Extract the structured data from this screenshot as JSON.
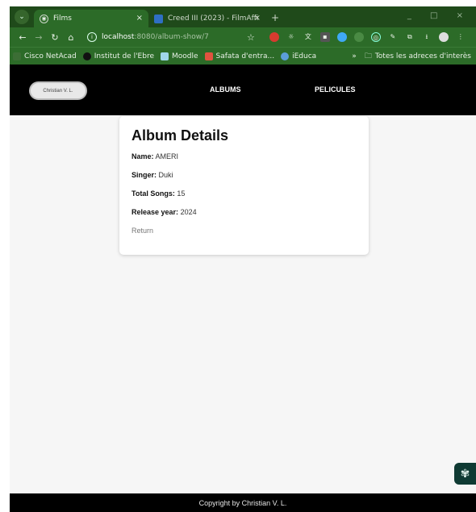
{
  "browser": {
    "tabs": [
      {
        "title": "Films",
        "close": "×"
      },
      {
        "title": "Creed III (2023) - FilmAffi",
        "close": "×"
      }
    ],
    "new_tab": "+",
    "url_host": "localhost",
    "url_path": ":8080/album-show/7",
    "bookmarks": [
      "Cisco NetAcad",
      "Institut de l'Ebre",
      "Moodle",
      "Safata d'entra...",
      "iEduca"
    ],
    "bookmarks_more": "»",
    "bookmarks_folder": "Totes les adreces d'interès"
  },
  "header": {
    "brand": "Christian V. L.",
    "nav": [
      "ALBUMS",
      "PELICULES"
    ]
  },
  "card": {
    "title": "Album Details",
    "fields": [
      {
        "label": "Name:",
        "value": "AMERI"
      },
      {
        "label": "Singer:",
        "value": "Duki"
      },
      {
        "label": "Total Songs:",
        "value": "15"
      },
      {
        "label": "Release year:",
        "value": "2024"
      }
    ],
    "return_label": "Return"
  },
  "footer": {
    "text": "Copyright by Christian V. L."
  },
  "colors": {
    "chrome_dark": "#1f4a1a",
    "chrome": "#2c6b28",
    "header": "#000000",
    "page_bg": "#f6f6f6"
  }
}
